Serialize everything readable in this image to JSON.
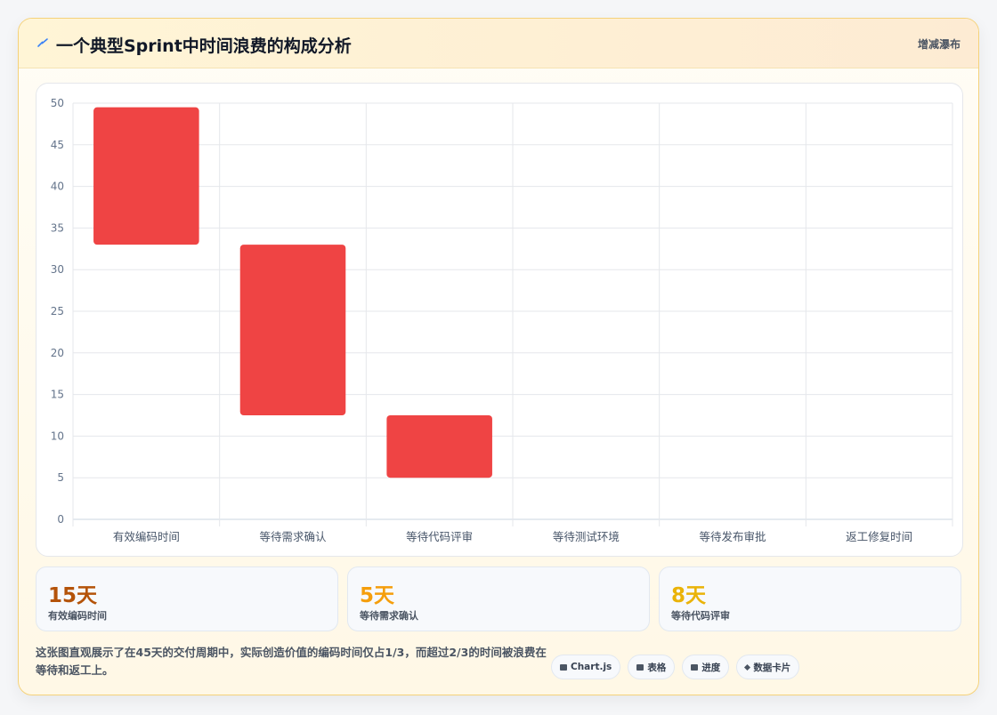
{
  "header": {
    "title": "一个典型Sprint中时间浪费的构成分析",
    "chart_type_label": "增减瀑布"
  },
  "chart_data": {
    "type": "bar",
    "subtype": "waterfall",
    "categories": [
      "有效编码时间",
      "等待需求确认",
      "等待代码评审",
      "等待测试环境",
      "等待发布审批",
      "返工修复时间"
    ],
    "ranges": [
      [
        33,
        49.5
      ],
      [
        12.5,
        33
      ],
      [
        5,
        12.5
      ],
      [
        null,
        null
      ],
      [
        null,
        null
      ],
      [
        null,
        null
      ]
    ],
    "ylim": [
      0,
      50
    ],
    "yticks": [
      0,
      5,
      10,
      15,
      20,
      25,
      30,
      35,
      40,
      45,
      50
    ],
    "bar_color": "#ef4444",
    "grid": true,
    "legend": "none"
  },
  "stats": [
    {
      "value": "15天",
      "label": "有效编码时间",
      "color": "#b45309"
    },
    {
      "value": "5天",
      "label": "等待需求确认",
      "color": "#f59e0b"
    },
    {
      "value": "8天",
      "label": "等待代码评审",
      "color": "#eab308"
    }
  ],
  "description": "这张图直观展示了在45天的交付周期中，实际创造价值的编码时间仅占1/3，而超过2/3的时间被浪费在等待和返工上。",
  "chips": [
    {
      "icon": "chart-icon",
      "label": "Chart.js"
    },
    {
      "icon": "table-icon",
      "label": "表格"
    },
    {
      "icon": "progress-icon",
      "label": "进度"
    },
    {
      "icon": "data-card-icon",
      "label": "数据卡片"
    }
  ]
}
